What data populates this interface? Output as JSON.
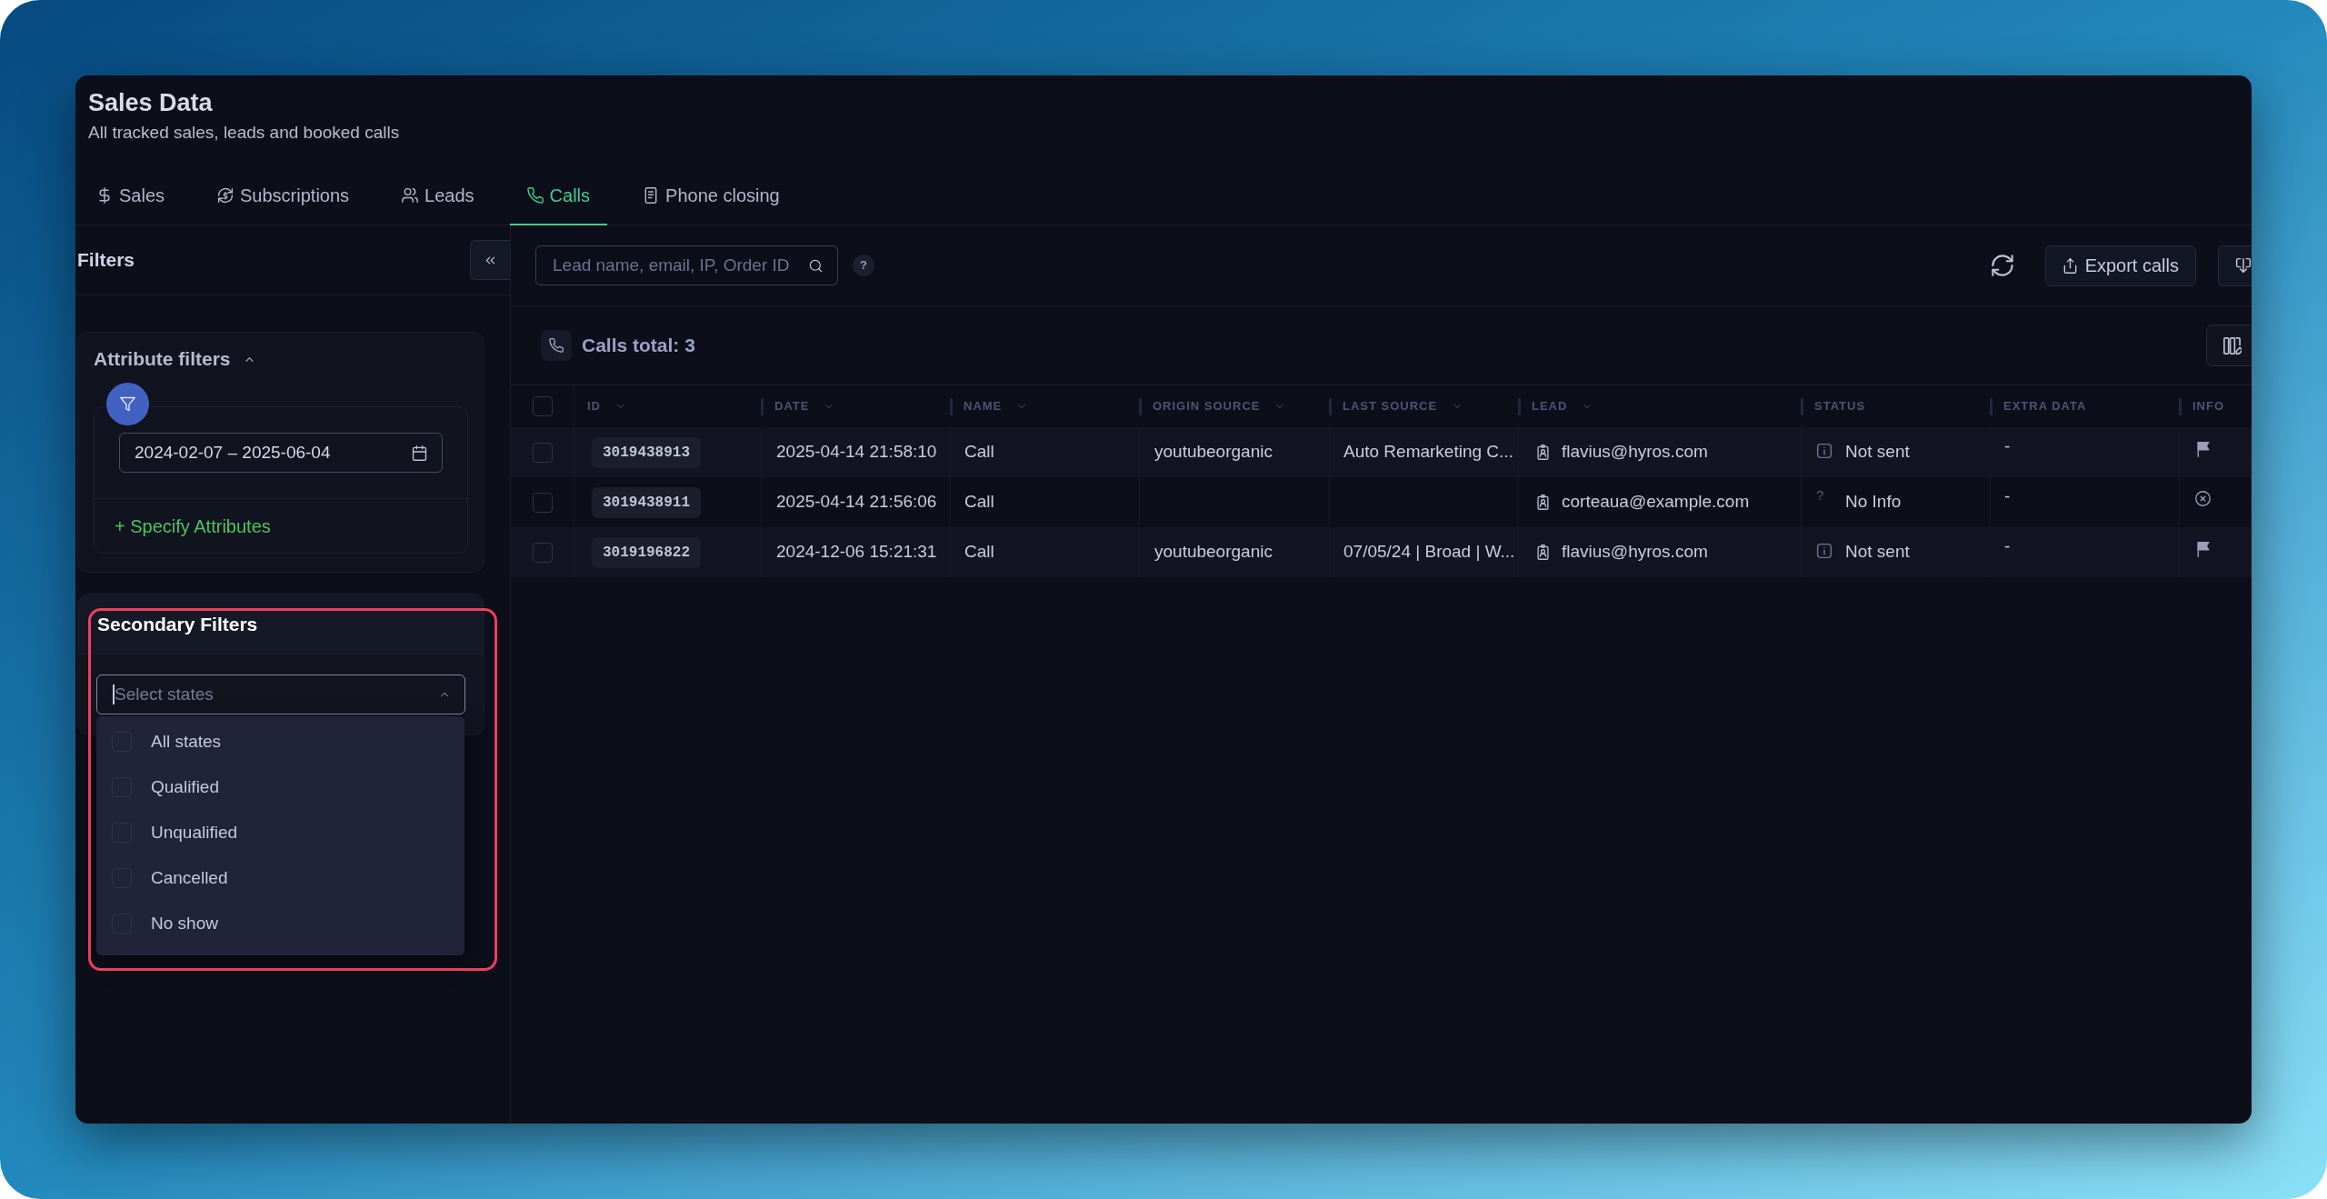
{
  "header": {
    "title": "Sales Data",
    "subtitle": "All tracked sales, leads and booked calls"
  },
  "tabs": [
    {
      "label": "Sales",
      "selected": false
    },
    {
      "label": "Subscriptions",
      "selected": false
    },
    {
      "label": "Leads",
      "selected": false
    },
    {
      "label": "Calls",
      "selected": true
    },
    {
      "label": "Phone closing",
      "selected": false
    }
  ],
  "filters_panel": {
    "title": "Filters",
    "attribute_filters": {
      "title": "Attribute filters",
      "expanded": true,
      "date_range": "2024-02-07 – 2025-06-04",
      "add_link": "+ Specify Attributes"
    },
    "secondary_filters": {
      "title": "Secondary Filters",
      "highlighted": true,
      "select": {
        "placeholder": "Select states",
        "expanded": true
      },
      "options": [
        {
          "label": "All states",
          "checked": false
        },
        {
          "label": "Qualified",
          "checked": false
        },
        {
          "label": "Unqualified",
          "checked": false
        },
        {
          "label": "Cancelled",
          "checked": false
        },
        {
          "label": "No show",
          "checked": false
        }
      ]
    }
  },
  "toolbar": {
    "search": {
      "placeholder": "Lead name, email, IP, Order ID"
    },
    "help_button": "?",
    "export_button": "Export calls"
  },
  "summary": {
    "title": "Calls total: 3"
  },
  "table": {
    "select_all": {
      "checked": false
    },
    "columns": [
      {
        "label": "ID",
        "sortable": true
      },
      {
        "label": "DATE",
        "sortable": true
      },
      {
        "label": "NAME",
        "sortable": true
      },
      {
        "label": "ORIGIN SOURCE",
        "sortable": true
      },
      {
        "label": "LAST SOURCE",
        "sortable": true
      },
      {
        "label": "LEAD",
        "sortable": true
      },
      {
        "label": "STATUS",
        "sortable": false
      },
      {
        "label": "EXTRA DATA",
        "sortable": false
      },
      {
        "label": "INFO",
        "sortable": false
      }
    ],
    "rows": [
      {
        "checked": false,
        "id": "3019438913",
        "date": "2025-04-14 21:58:10",
        "name": "Call",
        "origin_source": "youtubeorganic",
        "last_source": "Auto Remarketing C...",
        "lead": "flavius@hyros.com",
        "status": {
          "kind": "info",
          "label": "Not sent"
        },
        "extra_data": "-",
        "info": {
          "kind": "flagged"
        }
      },
      {
        "checked": false,
        "id": "3019438911",
        "date": "2025-04-14 21:56:06",
        "name": "Call",
        "lead": "corteaua@example.com",
        "status": {
          "kind": "unknown",
          "symbol": "?",
          "label": "No Info"
        },
        "extra_data": "-",
        "info": {
          "kind": "dismissed"
        }
      },
      {
        "checked": false,
        "id": "3019196822",
        "date": "2024-12-06 15:21:31",
        "name": "Call",
        "origin_source": "youtubeorganic",
        "last_source": "07/05/24 | Broad | W...",
        "lead": "flavius@hyros.com",
        "status": {
          "kind": "info",
          "label": "Not sent"
        },
        "extra_data": "-",
        "info": {
          "kind": "flagged"
        }
      }
    ]
  }
}
